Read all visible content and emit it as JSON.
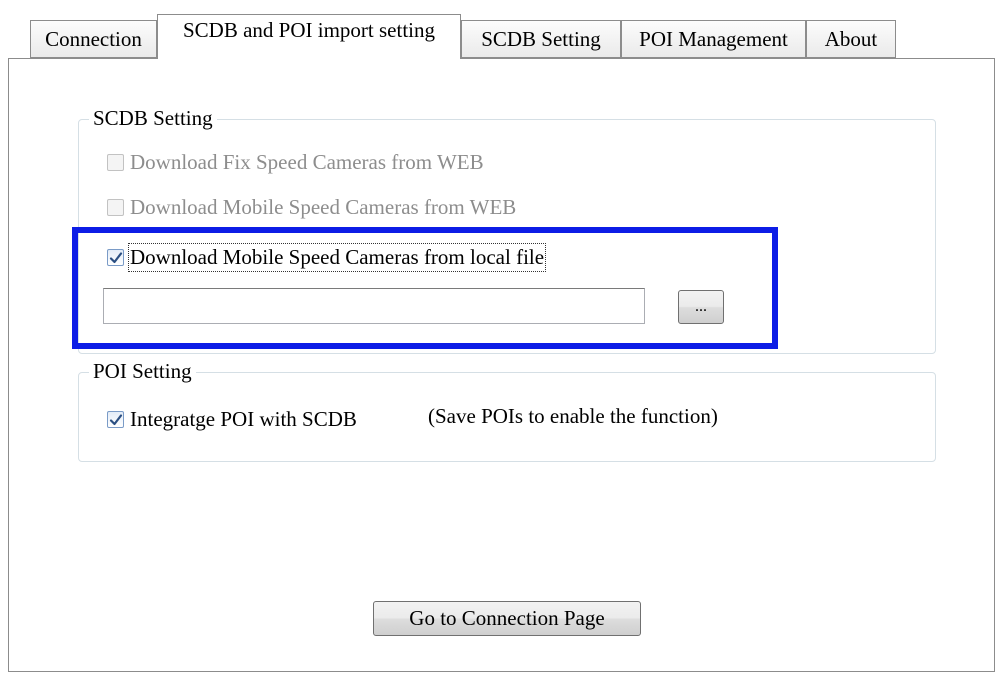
{
  "tabs": [
    {
      "label": "Connection",
      "active": false
    },
    {
      "label": "SCDB and POI import setting",
      "active": true
    },
    {
      "label": "SCDB  Setting",
      "active": false
    },
    {
      "label": "POI Management",
      "active": false
    },
    {
      "label": "About",
      "active": false
    }
  ],
  "scdb_group": {
    "legend": "SCDB  Setting",
    "opt_fix_web": {
      "label": "Download Fix Speed Cameras from WEB",
      "checked": false,
      "enabled": false
    },
    "opt_mobile_web": {
      "label": "Download Mobile Speed Cameras from WEB",
      "checked": false,
      "enabled": false
    },
    "opt_mobile_local": {
      "label": "Download Mobile Speed Cameras from local file",
      "checked": true,
      "enabled": true
    },
    "file_path": {
      "value": "",
      "placeholder": ""
    },
    "browse_label": "..."
  },
  "poi_group": {
    "legend": "POI Setting",
    "opt_integrate": {
      "label": "Integratge  POI with  SCDB",
      "checked": true,
      "enabled": true
    },
    "note": "(Save POIs to enable the function)"
  },
  "go_button_label": "Go to Connection Page",
  "colors": {
    "highlight": "#0d1de6",
    "check_mark": "#2b4f82"
  }
}
